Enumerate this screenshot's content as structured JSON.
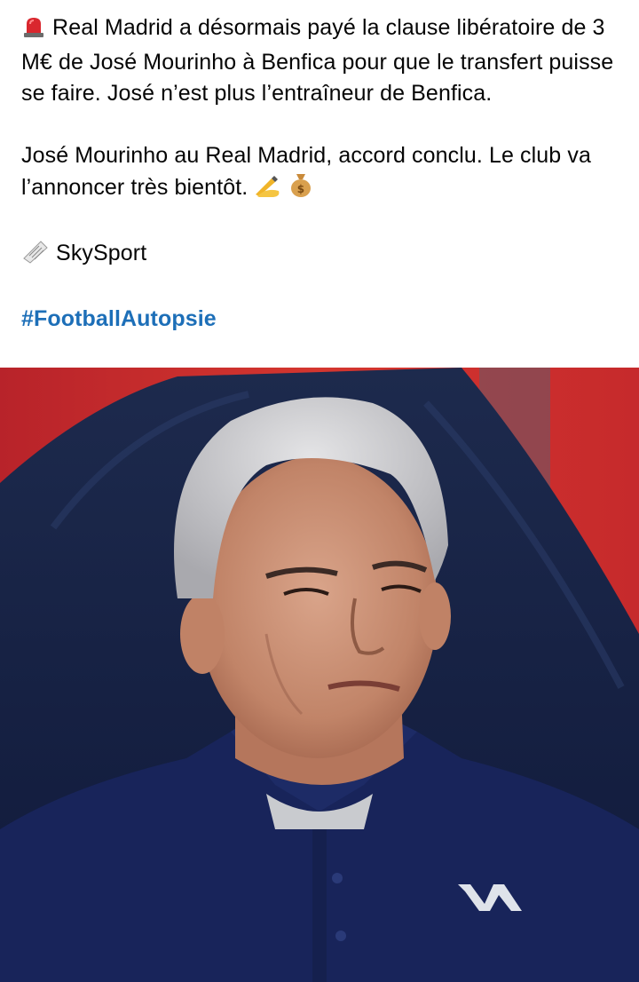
{
  "post": {
    "line1": "Real Madrid a désormais payé la clause libératoire de 3 M€ de José Mourinho à Benfica pour que le transfert puisse se faire. José n’est plus l’entraîneur de Benfica.",
    "line2": "José Mourinho au Real Madrid, accord conclu. Le club va l’annoncer très bientôt.",
    "source": "SkySport",
    "hashtag": "#FootballAutopsie"
  },
  "icons": {
    "lead": "siren-icon",
    "signed": "writing-hand-icon",
    "money": "money-bag-icon",
    "source": "newspaper-icon"
  },
  "colors": {
    "text": "#050505",
    "hashtag": "#1d6fb8",
    "siren": "#d9272e",
    "shirt": "#1a2a5e",
    "background_red": "#c8262a"
  }
}
